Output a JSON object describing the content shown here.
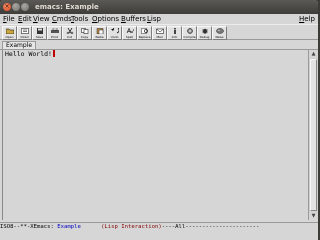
{
  "window": {
    "title": "emacs: Example"
  },
  "menubar": {
    "items": [
      {
        "accel": "F",
        "rest": "ile"
      },
      {
        "accel": "E",
        "rest": "dit"
      },
      {
        "accel": "V",
        "rest": "iew"
      },
      {
        "accel": "C",
        "rest": "mds"
      },
      {
        "accel": "T",
        "rest": "ools"
      },
      {
        "accel": "O",
        "rest": "ptions"
      },
      {
        "accel": "B",
        "rest": "uffers"
      },
      {
        "accel": "L",
        "rest": "isp"
      }
    ],
    "help": {
      "accel": "H",
      "rest": "elp"
    }
  },
  "toolbar": {
    "buttons": [
      {
        "label": "Open",
        "icon": "folder-open-icon"
      },
      {
        "label": "Dired",
        "icon": "dired-icon"
      },
      {
        "label": "Save",
        "icon": "save-icon"
      },
      {
        "label": "Print",
        "icon": "print-icon"
      },
      {
        "label": "Cut",
        "icon": "cut-icon"
      },
      {
        "label": "Copy",
        "icon": "copy-icon"
      },
      {
        "label": "Paste",
        "icon": "paste-icon"
      },
      {
        "label": "Undo",
        "icon": "undo-icon"
      },
      {
        "label": "Spell",
        "icon": "spell-icon"
      },
      {
        "label": "Replace",
        "icon": "replace-icon"
      },
      {
        "label": "Mail",
        "icon": "mail-icon"
      },
      {
        "label": "Info",
        "icon": "info-icon"
      },
      {
        "label": "Compile",
        "icon": "compile-icon"
      },
      {
        "label": "Debug",
        "icon": "debug-icon"
      },
      {
        "label": "News",
        "icon": "news-icon"
      }
    ]
  },
  "tabs": [
    {
      "label": "Example"
    }
  ],
  "buffer": {
    "text": "Hello World!"
  },
  "modeline": {
    "prefix": "ISO8--**-XEmacs: ",
    "buffer_name": "Example",
    "gap": "      ",
    "mode": "(Lisp Interaction)",
    "suffix": "----All----------------------"
  },
  "colors": {
    "cursor": "#c00000",
    "close_button": "#e0582e"
  }
}
